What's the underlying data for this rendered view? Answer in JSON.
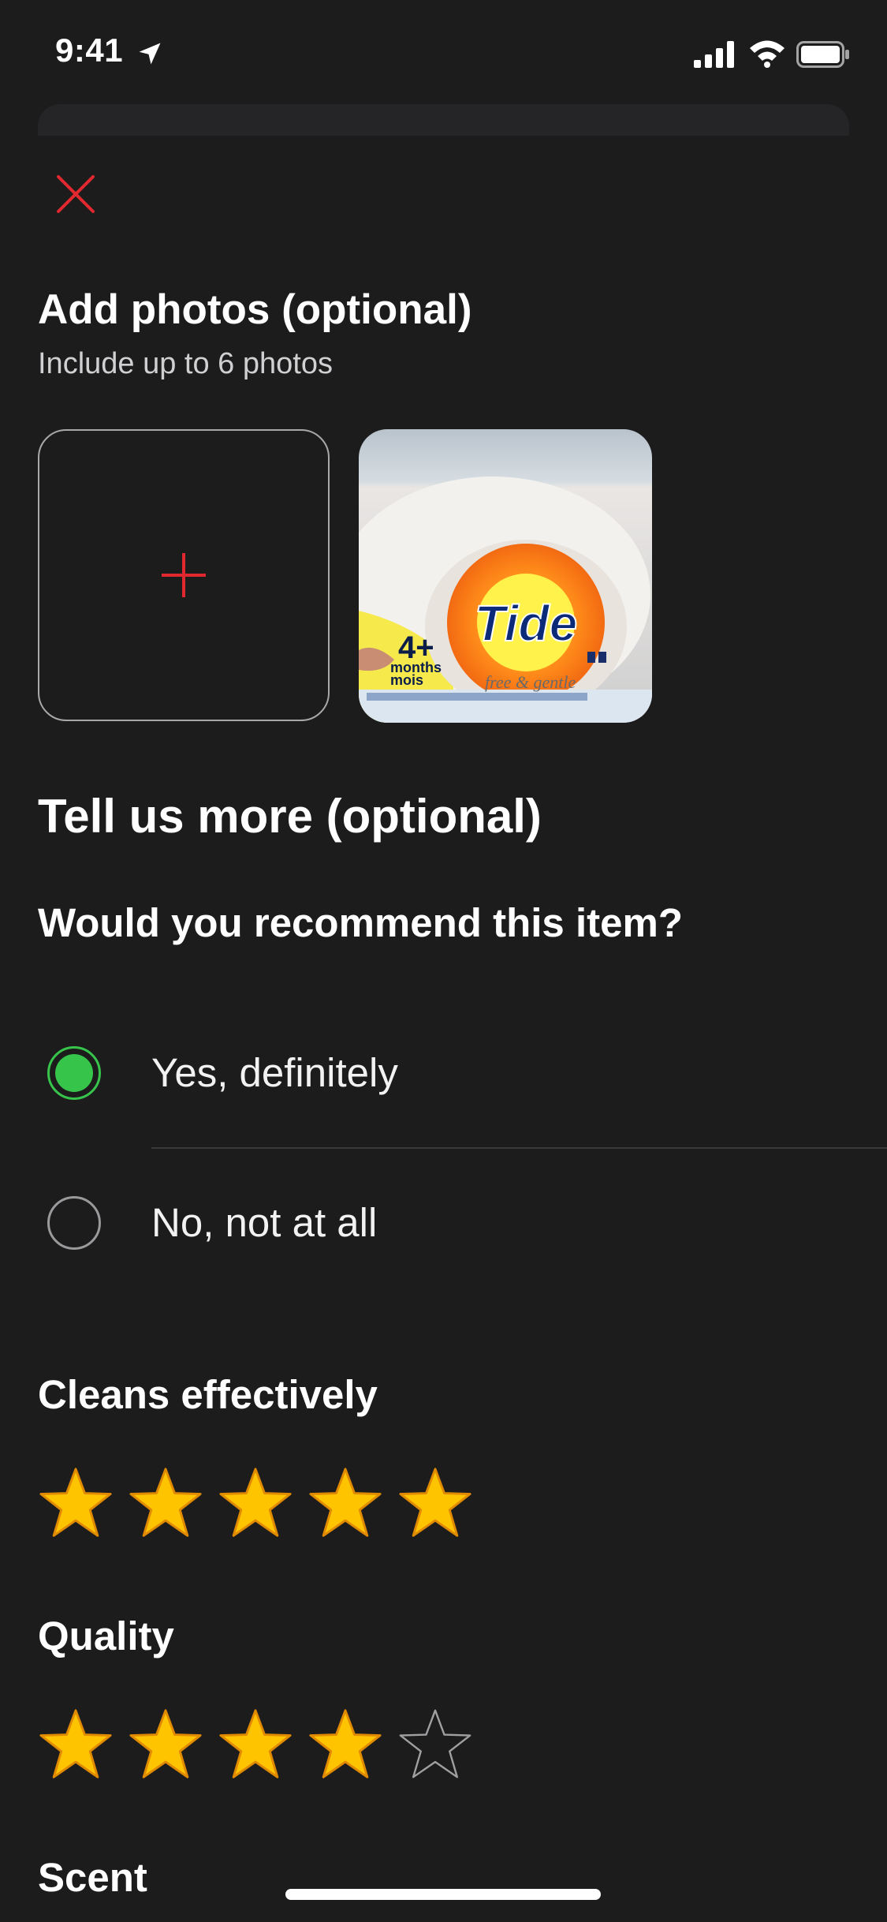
{
  "status_bar": {
    "time": "9:41"
  },
  "form": {
    "photos": {
      "title": "Add photos (optional)",
      "subtitle": "Include up to 6 photos",
      "thumbnail_text": {
        "brand": "Tide",
        "variant": "free & gentle",
        "badge": "4+",
        "badge_line1": "months",
        "badge_line2": "mois"
      }
    },
    "more": {
      "title": "Tell us more (optional)"
    },
    "recommend": {
      "question": "Would you recommend this item?",
      "options": [
        {
          "label": "Yes, definitely",
          "selected": true
        },
        {
          "label": "No, not at all",
          "selected": false
        }
      ]
    },
    "ratings": [
      {
        "label": "Cleans effectively",
        "stars": 5,
        "max": 5
      },
      {
        "label": "Quality",
        "stars": 4,
        "max": 5
      },
      {
        "label": "Scent"
      }
    ]
  },
  "colors": {
    "accent": "#e0282e",
    "selected_radio": "#37c44a",
    "star_fill": "#ffc400",
    "star_outline": "#e08a00",
    "background": "#1c1c1d"
  },
  "icons": [
    "location-arrow-icon",
    "signal-icon",
    "wifi-icon",
    "battery-icon",
    "close-icon",
    "plus-icon",
    "star-icon"
  ]
}
